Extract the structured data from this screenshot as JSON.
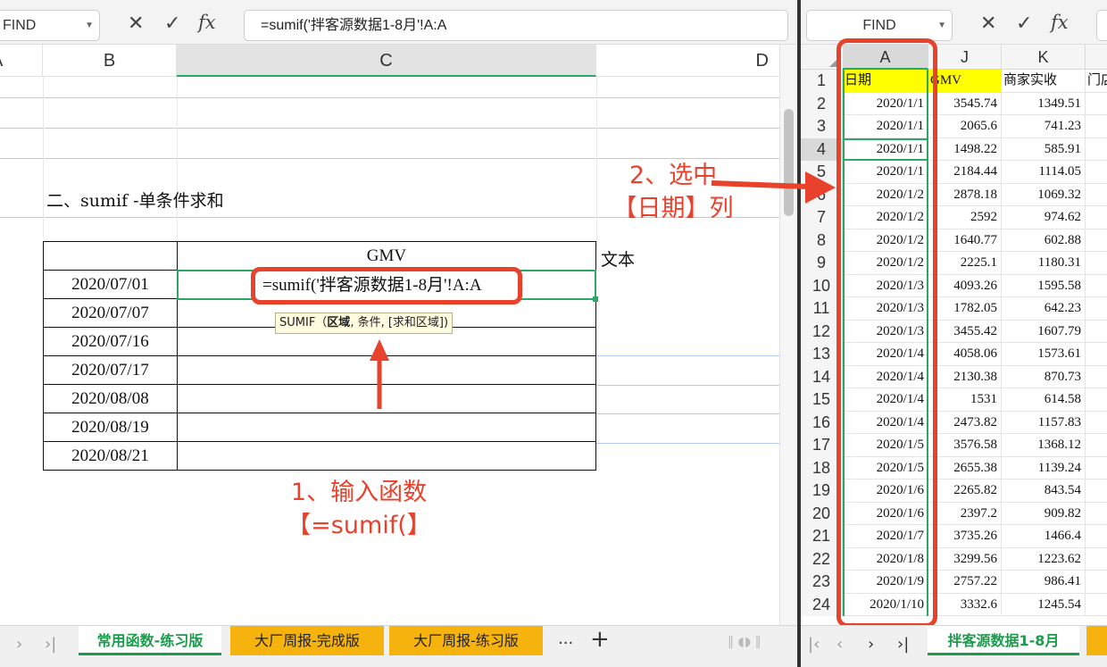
{
  "left": {
    "name_box": "FIND",
    "formula": "=sumif('拌客源数据1-8月'!A:A",
    "columns": [
      "A",
      "B",
      "C",
      "D"
    ],
    "section_title": "二、sumif -单条件求和",
    "table": {
      "header": "GMV",
      "dates": [
        "2020/07/01",
        "2020/07/07",
        "2020/07/16",
        "2020/07/17",
        "2020/08/08",
        "2020/08/19",
        "2020/08/21"
      ]
    },
    "text_label": "文本",
    "cell_formula": "=sumif('拌客源数据1-8月'!A:A",
    "tooltip": {
      "fn": "SUMIF（",
      "bold_arg": "区域",
      "rest": ", 条件, [求和区域])"
    },
    "annotation_step1": {
      "line1": "1、输入函数",
      "line2": "【=sumif(】"
    },
    "tabs": [
      "常用函数-练习版",
      "大厂周报-完成版",
      "大厂周报-练习版"
    ],
    "tab_more": "...",
    "tab_add": "+",
    "nav": [
      "›",
      "›|"
    ]
  },
  "right": {
    "name_box": "FIND",
    "columns": [
      "A",
      "J",
      "K"
    ],
    "header_row": {
      "num": "1",
      "a": "日期",
      "j": "GMV",
      "k": "商家实收",
      "l": "门店"
    },
    "rows": [
      {
        "num": "2",
        "a": "2020/1/1",
        "j": "3545.74",
        "k": "1349.51"
      },
      {
        "num": "3",
        "a": "2020/1/1",
        "j": "2065.6",
        "k": "741.23"
      },
      {
        "num": "4",
        "a": "2020/1/1",
        "j": "1498.22",
        "k": "585.91"
      },
      {
        "num": "5",
        "a": "2020/1/1",
        "j": "2184.44",
        "k": "1114.05"
      },
      {
        "num": "6",
        "a": "2020/1/2",
        "j": "2878.18",
        "k": "1069.32"
      },
      {
        "num": "7",
        "a": "2020/1/2",
        "j": "2592",
        "k": "974.62"
      },
      {
        "num": "8",
        "a": "2020/1/2",
        "j": "1640.77",
        "k": "602.88"
      },
      {
        "num": "9",
        "a": "2020/1/2",
        "j": "2225.1",
        "k": "1180.31"
      },
      {
        "num": "10",
        "a": "2020/1/3",
        "j": "4093.26",
        "k": "1595.58"
      },
      {
        "num": "11",
        "a": "2020/1/3",
        "j": "1782.05",
        "k": "642.23"
      },
      {
        "num": "12",
        "a": "2020/1/3",
        "j": "3455.42",
        "k": "1607.79"
      },
      {
        "num": "13",
        "a": "2020/1/4",
        "j": "4058.06",
        "k": "1573.61"
      },
      {
        "num": "14",
        "a": "2020/1/4",
        "j": "2130.38",
        "k": "870.73"
      },
      {
        "num": "15",
        "a": "2020/1/4",
        "j": "1531",
        "k": "614.58"
      },
      {
        "num": "16",
        "a": "2020/1/4",
        "j": "2473.82",
        "k": "1157.83"
      },
      {
        "num": "17",
        "a": "2020/1/5",
        "j": "3576.58",
        "k": "1368.12"
      },
      {
        "num": "18",
        "a": "2020/1/5",
        "j": "2655.38",
        "k": "1139.24"
      },
      {
        "num": "19",
        "a": "2020/1/6",
        "j": "2265.82",
        "k": "843.54"
      },
      {
        "num": "20",
        "a": "2020/1/6",
        "j": "2397.2",
        "k": "909.82"
      },
      {
        "num": "21",
        "a": "2020/1/7",
        "j": "3735.26",
        "k": "1466.4"
      },
      {
        "num": "22",
        "a": "2020/1/8",
        "j": "3299.56",
        "k": "1223.62"
      },
      {
        "num": "23",
        "a": "2020/1/9",
        "j": "2757.22",
        "k": "986.41"
      },
      {
        "num": "24",
        "a": "2020/1/10",
        "j": "3332.6",
        "k": "1245.54"
      }
    ],
    "tab": "拌客源数据1-8月",
    "nav": [
      "|‹",
      "‹",
      "›",
      "›|"
    ]
  },
  "annotation_step2": {
    "line1": "2、选中",
    "line2": "【日期】列"
  },
  "colors": {
    "accent_red": "#e8412c",
    "select_green": "#2ca866",
    "tab_orange": "#f7b30d",
    "header_yellow": "#ffff00"
  }
}
